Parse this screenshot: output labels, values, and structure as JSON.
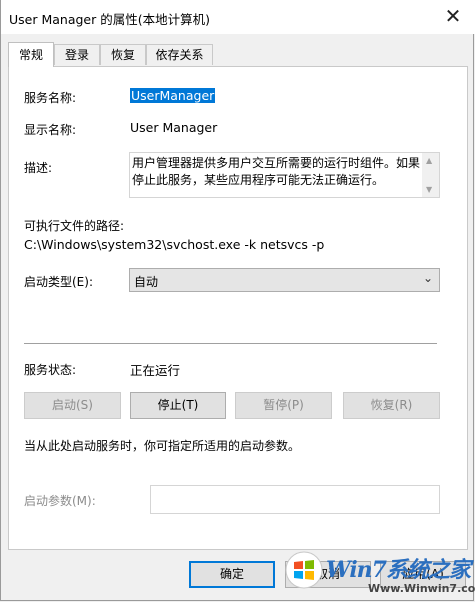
{
  "window": {
    "title": "User Manager 的属性(本地计算机)"
  },
  "tabs": [
    {
      "label": "常规",
      "active": true
    },
    {
      "label": "登录",
      "active": false
    },
    {
      "label": "恢复",
      "active": false
    },
    {
      "label": "依存关系",
      "active": false
    }
  ],
  "general": {
    "service_name_label": "服务名称:",
    "service_name_value": "UserManager",
    "display_name_label": "显示名称:",
    "display_name_value": "User Manager",
    "description_label": "描述:",
    "description_value": "用户管理器提供多用户交互所需要的运行时组件。如果停止此服务，某些应用程序可能无法正确运行。",
    "exe_path_label": "可执行文件的路径:",
    "exe_path_value": "C:\\Windows\\system32\\svchost.exe -k netsvcs -p",
    "startup_type_label": "启动类型(E):",
    "startup_type_value": "自动",
    "status_label": "服务状态:",
    "status_value": "正在运行",
    "buttons": {
      "start": "启动(S)",
      "stop": "停止(T)",
      "pause": "暂停(P)",
      "resume": "恢复(R)"
    },
    "hint": "当从此处启动服务时，你可指定所适用的启动参数。",
    "start_params_label": "启动参数(M):",
    "start_params_value": ""
  },
  "footer": {
    "ok": "确定",
    "cancel": "取消",
    "apply": "应用(A)"
  },
  "watermark": {
    "text": "Win7系统之家",
    "url": "Www.Winwin7.com"
  }
}
